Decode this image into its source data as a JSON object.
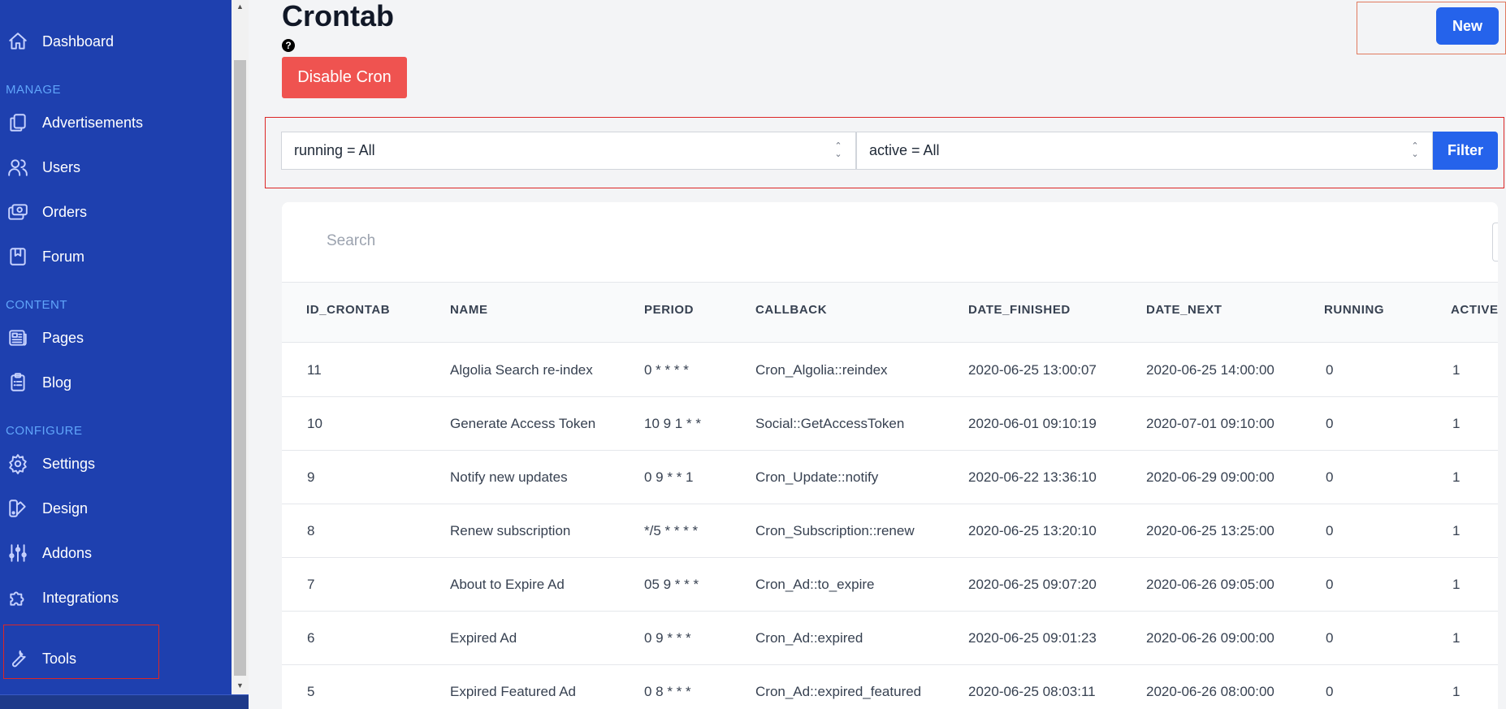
{
  "sidebar": {
    "items": [
      {
        "label": "Dashboard",
        "icon": "home-icon"
      },
      {
        "label": "Advertisements",
        "icon": "documents-icon"
      },
      {
        "label": "Users",
        "icon": "users-icon"
      },
      {
        "label": "Orders",
        "icon": "cash-icon"
      },
      {
        "label": "Forum",
        "icon": "book-icon"
      },
      {
        "label": "Pages",
        "icon": "newspaper-icon"
      },
      {
        "label": "Blog",
        "icon": "clipboard-icon"
      },
      {
        "label": "Settings",
        "icon": "gear-icon"
      },
      {
        "label": "Design",
        "icon": "palette-icon"
      },
      {
        "label": "Addons",
        "icon": "sliders-icon"
      },
      {
        "label": "Integrations",
        "icon": "puzzle-icon"
      },
      {
        "label": "Tools",
        "icon": "wrench-icon"
      }
    ],
    "sections": {
      "manage": "MANAGE",
      "content": "CONTENT",
      "configure": "CONFIGURE"
    }
  },
  "header": {
    "title": "Crontab",
    "help": "?",
    "disable_label": "Disable Cron",
    "new_label": "New"
  },
  "filters": {
    "running": "running = All",
    "active": "active = All",
    "filter_label": "Filter"
  },
  "search": {
    "placeholder": "Search"
  },
  "table": {
    "columns": [
      "ID_CRONTAB",
      "NAME",
      "PERIOD",
      "CALLBACK",
      "DATE_FINISHED",
      "DATE_NEXT",
      "RUNNING",
      "ACTIVE"
    ],
    "rows": [
      [
        "11",
        "Algolia Search re-index",
        "0 * * * *",
        "Cron_Algolia::reindex",
        "2020-06-25 13:00:07",
        "2020-06-25 14:00:00",
        "0",
        "1"
      ],
      [
        "10",
        "Generate Access Token",
        "10 9 1 * *",
        "Social::GetAccessToken",
        "2020-06-01 09:10:19",
        "2020-07-01 09:10:00",
        "0",
        "1"
      ],
      [
        "9",
        "Notify new updates",
        "0 9 * * 1",
        "Cron_Update::notify",
        "2020-06-22 13:36:10",
        "2020-06-29 09:00:00",
        "0",
        "1"
      ],
      [
        "8",
        "Renew subscription",
        "*/5 * * * *",
        "Cron_Subscription::renew",
        "2020-06-25 13:20:10",
        "2020-06-25 13:25:00",
        "0",
        "1"
      ],
      [
        "7",
        "About to Expire Ad",
        "05 9 * * *",
        "Cron_Ad::to_expire",
        "2020-06-25 09:07:20",
        "2020-06-26 09:05:00",
        "0",
        "1"
      ],
      [
        "6",
        "Expired Ad",
        "0 9 * * *",
        "Cron_Ad::expired",
        "2020-06-25 09:01:23",
        "2020-06-26 09:00:00",
        "0",
        "1"
      ],
      [
        "5",
        "Expired Featured Ad",
        "0 8 * * *",
        "Cron_Ad::expired_featured",
        "2020-06-25 08:03:11",
        "2020-06-26 08:00:00",
        "0",
        "1"
      ]
    ]
  },
  "colors": {
    "sidebar": "#1e40af",
    "primary": "#2563eb",
    "danger": "#ef5350",
    "highlight": "#dc2626"
  }
}
